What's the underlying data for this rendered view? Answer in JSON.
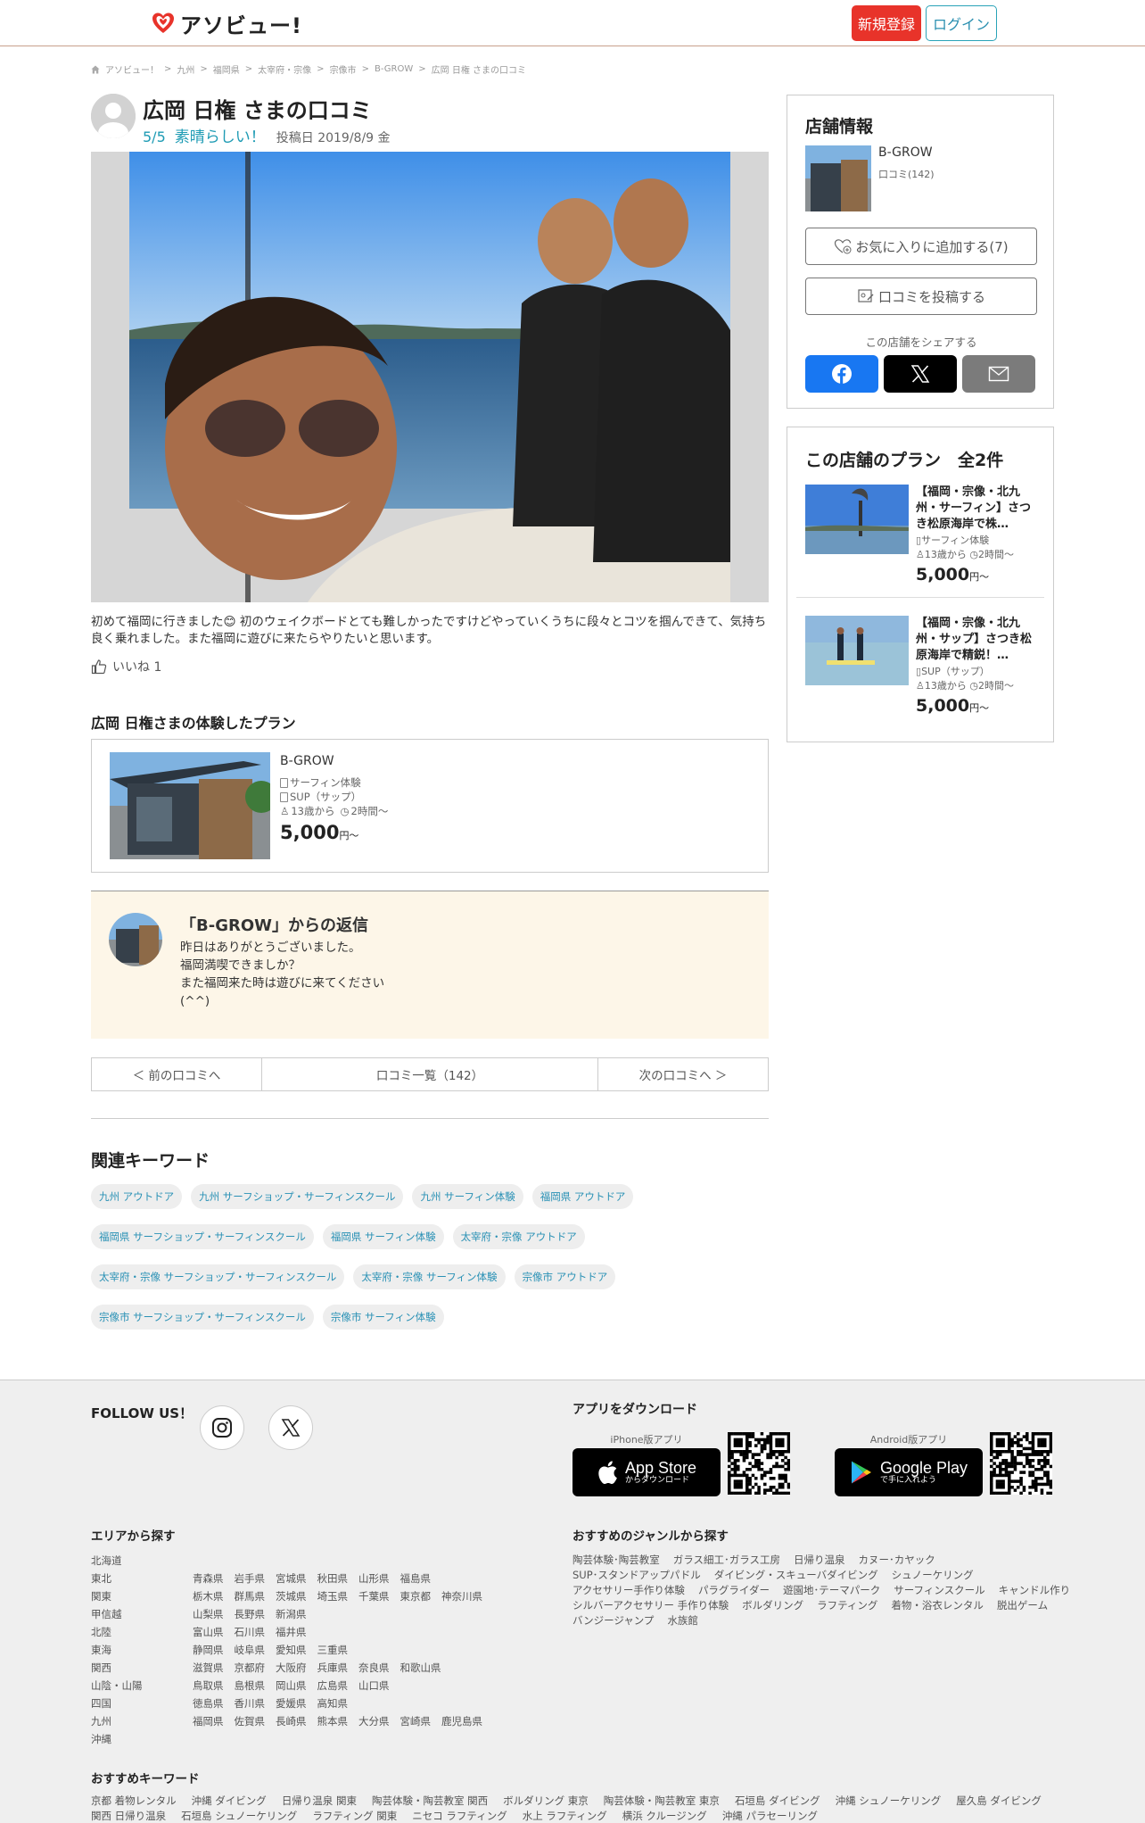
{
  "header": {
    "logo_text": "アソビュー!",
    "register": "新規登録",
    "login": "ログイン"
  },
  "breadcrumb": [
    "アソビュー！",
    ">",
    "九州",
    ">",
    "福岡県",
    ">",
    "太宰府・宗像",
    ">",
    "宗像市",
    ">",
    "B-GROW",
    ">",
    "広岡 日権 さまの口コミ"
  ],
  "review": {
    "title": "広岡 日権 さまの口コミ",
    "score": "5/5",
    "label": "素晴らしい！",
    "date": "投稿日 2019/8/9 金",
    "text": "初めて福岡に行きました😊 初のウェイクボードとても難しかったですけどやっていくうちに段々とコツを掴んできて、気持ち良く乗れました。また福岡に遊びに来たらやりたいと思います。",
    "like": "いいね 1"
  },
  "experience": {
    "title": "広岡 日権さまの体験したプラン",
    "shop": "B-GROW",
    "tag1": "サーフィン体験",
    "tag2": "SUP（サップ）",
    "age": "13歳から",
    "duration": "2時間～",
    "price": "5,000",
    "price_unit": "円～"
  },
  "reply": {
    "title": "「B-GROW」からの返信",
    "lines": [
      "昨日はありがとうございました。",
      "福岡満喫できましか？",
      "また福岡来た時は遊びに来てください",
      "(^^)"
    ]
  },
  "pager": {
    "prev": "＜ 前の口コミへ",
    "list": "口コミ一覧（142）",
    "next": "次の口コミへ ＞"
  },
  "keywords": {
    "title": "関連キーワード",
    "tags": [
      "九州 アウトドア",
      "九州 サーフショップ・サーフィンスクール",
      "九州 サーフィン体験",
      "福岡県 アウトドア",
      "福岡県 サーフショップ・サーフィンスクール",
      "福岡県 サーフィン体験",
      "太宰府・宗像 アウトドア",
      "太宰府・宗像 サーフショップ・サーフィンスクール",
      "太宰府・宗像 サーフィン体験",
      "宗像市 アウトドア",
      "宗像市 サーフショップ・サーフィンスクール",
      "宗像市 サーフィン体験"
    ]
  },
  "shop_info": {
    "title": "店舗情報",
    "name": "B-GROW",
    "reviews": "口コミ(142)",
    "favorite": "お気に入りに追加する(7)",
    "post_review": "口コミを投稿する",
    "share_label": "この店舗をシェアする"
  },
  "plans": {
    "title": "この店舗のプラン　全2件",
    "items": [
      {
        "title": "【福岡・宗像・北九州・サーフィン】さつき松原海岸で株…",
        "tag": "サーフィン体験",
        "meta": "13歳から",
        "duration": "2時間～",
        "price": "5,000",
        "unit": "円～"
      },
      {
        "title": "【福岡・宗像・北九州・サップ】さつき松原海岸で精鋭！…",
        "tag": "SUP（サップ）",
        "meta": "13歳から",
        "duration": "2時間～",
        "price": "5,000",
        "unit": "円～"
      }
    ]
  },
  "footer": {
    "follow": "FOLLOW US！",
    "app_title": "アプリをダウンロード",
    "iphone_cap": "iPhone版アプリ",
    "android_cap": "Android版アプリ",
    "appstore_big": "App Store",
    "appstore_small": "からダウンロード",
    "gplay_big": "Google Play",
    "gplay_small": "で手に入れよう",
    "area_title": "エリアから探す",
    "genre_title": "おすすめのジャンルから探す",
    "kw_title": "おすすめキーワード",
    "regions": [
      {
        "name": "北海道",
        "prefs": []
      },
      {
        "name": "東北",
        "prefs": [
          "青森県",
          "岩手県",
          "宮城県",
          "秋田県",
          "山形県",
          "福島県"
        ]
      },
      {
        "name": "関東",
        "prefs": [
          "栃木県",
          "群馬県",
          "茨城県",
          "埼玉県",
          "千葉県",
          "東京都",
          "神奈川県"
        ]
      },
      {
        "name": "甲信越",
        "prefs": [
          "山梨県",
          "長野県",
          "新潟県"
        ]
      },
      {
        "name": "北陸",
        "prefs": [
          "富山県",
          "石川県",
          "福井県"
        ]
      },
      {
        "name": "東海",
        "prefs": [
          "静岡県",
          "岐阜県",
          "愛知県",
          "三重県"
        ]
      },
      {
        "name": "関西",
        "prefs": [
          "滋賀県",
          "京都府",
          "大阪府",
          "兵庫県",
          "奈良県",
          "和歌山県"
        ]
      },
      {
        "name": "山陰・山陽",
        "prefs": [
          "鳥取県",
          "島根県",
          "岡山県",
          "広島県",
          "山口県"
        ]
      },
      {
        "name": "四国",
        "prefs": [
          "徳島県",
          "香川県",
          "愛媛県",
          "高知県"
        ]
      },
      {
        "name": "九州",
        "prefs": [
          "福岡県",
          "佐賀県",
          "長崎県",
          "熊本県",
          "大分県",
          "宮崎県",
          "鹿児島県"
        ]
      },
      {
        "name": "沖縄",
        "prefs": []
      }
    ],
    "genres": [
      "陶芸体験･陶芸教室",
      "ガラス細工･ガラス工房",
      "日帰り温泉",
      "カヌー･カヤック",
      "SUP･スタンドアップパドル",
      "ダイビング・スキューバダイビング",
      "シュノーケリング",
      "アクセサリー手作り体験",
      "パラグライダー",
      "遊園地･テーマパーク",
      "サーフィンスクール",
      "キャンドル作り",
      "シルバーアクセサリー 手作り体験",
      "ボルダリング",
      "ラフティング",
      "着物・浴衣レンタル",
      "脱出ゲーム",
      "バンジージャンプ",
      "水族館"
    ],
    "keywords": [
      "京都 着物レンタル",
      "沖縄 ダイビング",
      "日帰り温泉 関東",
      "陶芸体験・陶芸教室 関西",
      "ボルダリング 東京",
      "陶芸体験・陶芸教室 東京",
      "石垣島 ダイビング",
      "沖縄 シュノーケリング",
      "屋久島 ダイビング",
      "関西 日帰り温泉",
      "石垣島 シュノーケリング",
      "ラフティング 関東",
      "ニセコ ラフティング",
      "水上 ラフティング",
      "横浜 クルージング",
      "沖縄 パラセーリング"
    ]
  }
}
